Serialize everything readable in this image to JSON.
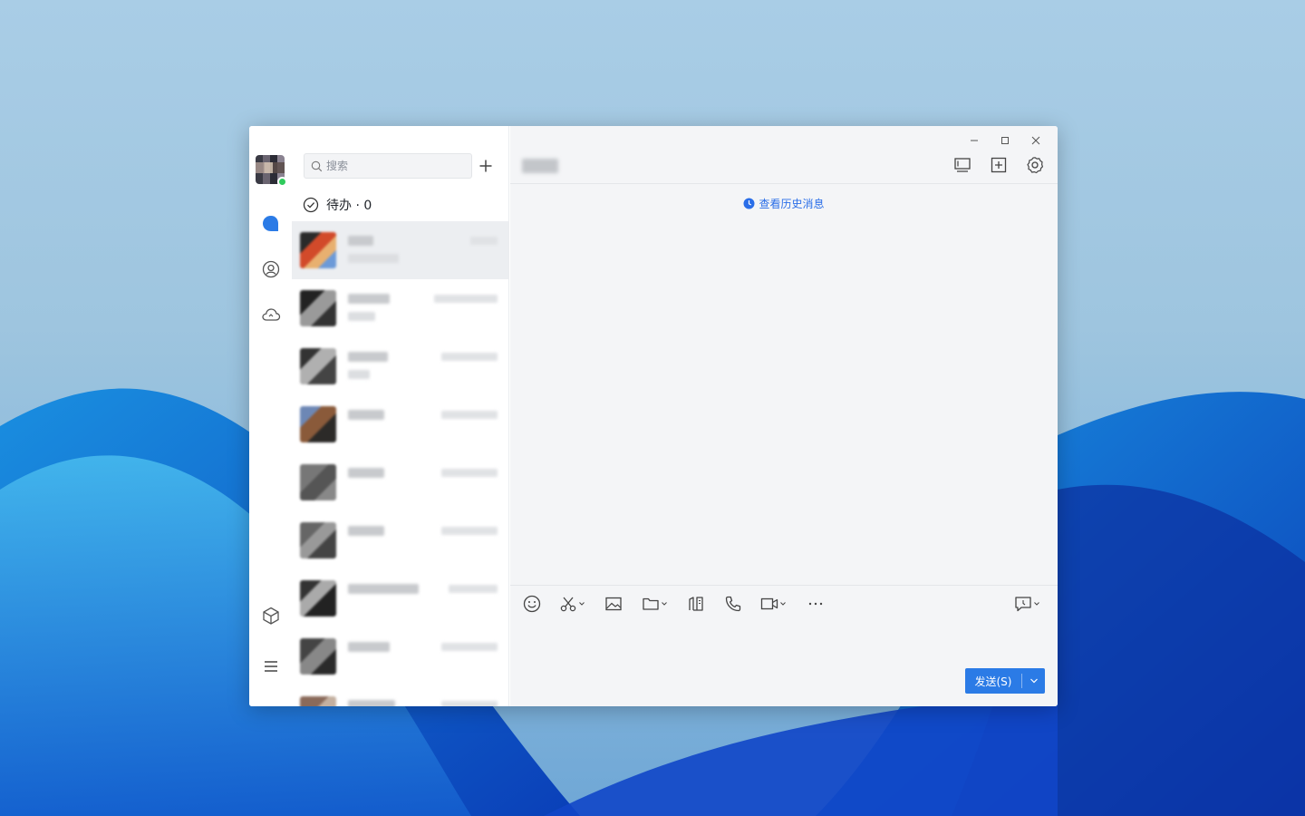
{
  "search": {
    "placeholder": "搜索"
  },
  "todo": {
    "label": "待办 · 0"
  },
  "chat": {
    "history_link": "查看历史消息",
    "send_label": "发送(S)"
  },
  "colors": {
    "accent": "#2b7be6",
    "link": "#2a6ee8",
    "online": "#2fcb5c"
  },
  "nav_icons": [
    "messages-icon",
    "contacts-icon",
    "cloud-icon",
    "workbench-icon",
    "menu-icon"
  ],
  "conversations": [
    {
      "id": "conv-1",
      "active": true
    },
    {
      "id": "conv-2",
      "active": false
    },
    {
      "id": "conv-3",
      "active": false
    },
    {
      "id": "conv-4",
      "active": false
    },
    {
      "id": "conv-5",
      "active": false
    },
    {
      "id": "conv-6",
      "active": false
    },
    {
      "id": "conv-7",
      "active": false
    },
    {
      "id": "conv-8",
      "active": false
    },
    {
      "id": "conv-9",
      "active": false
    }
  ]
}
